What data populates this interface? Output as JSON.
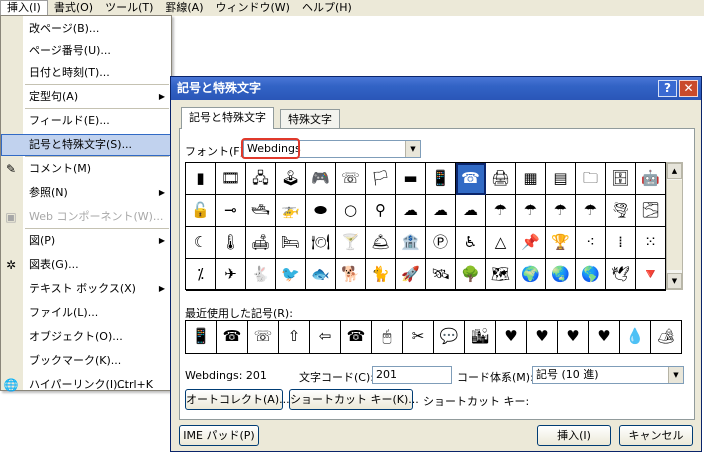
{
  "menubar": {
    "items": [
      "挿入(I)",
      "書式(O)",
      "ツール(T)",
      "罫線(A)",
      "ウィンドウ(W)",
      "ヘルプ(H)"
    ]
  },
  "menu": {
    "items": [
      {
        "label": "改ページ(B)...",
        "arrow": "",
        "shortcut": "",
        "icon": "",
        "state": "normal"
      },
      {
        "label": "ページ番号(U)...",
        "arrow": "",
        "shortcut": "",
        "icon": "",
        "state": "normal"
      },
      {
        "label": "日付と時刻(T)...",
        "arrow": "",
        "shortcut": "",
        "icon": "",
        "state": "normal"
      },
      {
        "label": "定型句(A)",
        "arrow": "▶",
        "shortcut": "",
        "icon": "",
        "state": "normal"
      },
      {
        "label": "フィールド(E)...",
        "arrow": "",
        "shortcut": "",
        "icon": "",
        "state": "normal"
      },
      {
        "label": "記号と特殊文字(S)...",
        "arrow": "",
        "shortcut": "",
        "icon": "",
        "state": "highlight"
      },
      {
        "label": "コメント(M)",
        "arrow": "",
        "shortcut": "",
        "icon": "✎",
        "state": "normal"
      },
      {
        "label": "参照(N)",
        "arrow": "▶",
        "shortcut": "",
        "icon": "",
        "state": "normal"
      },
      {
        "label": "Web コンポーネント(W)...",
        "arrow": "",
        "shortcut": "",
        "icon": "▣",
        "state": "disabled"
      },
      {
        "label": "図(P)",
        "arrow": "▶",
        "shortcut": "",
        "icon": "",
        "state": "normal"
      },
      {
        "label": "図表(G)...",
        "arrow": "",
        "shortcut": "",
        "icon": "✲",
        "state": "normal"
      },
      {
        "label": "テキスト ボックス(X)",
        "arrow": "▶",
        "shortcut": "",
        "icon": "",
        "state": "normal"
      },
      {
        "label": "ファイル(L)...",
        "arrow": "",
        "shortcut": "",
        "icon": "",
        "state": "normal"
      },
      {
        "label": "オブジェクト(O)...",
        "arrow": "",
        "shortcut": "",
        "icon": "",
        "state": "normal"
      },
      {
        "label": "ブックマーク(K)...",
        "arrow": "",
        "shortcut": "",
        "icon": "",
        "state": "normal"
      },
      {
        "label": "ハイパーリンク(I)...",
        "arrow": "",
        "shortcut": "Ctrl+K",
        "icon": "🌐",
        "state": "normal"
      }
    ]
  },
  "dialog": {
    "title": "記号と特殊文字",
    "help_btn": "?",
    "close_btn": "✕",
    "tabs": [
      "記号と特殊文字",
      "特殊文字"
    ],
    "font_label": "フォント(F):",
    "font_value": "Webdings",
    "grid_rows": [
      [
        "▮",
        "🎞",
        "🖧",
        "🕹",
        "🎮",
        "☏",
        "🏳",
        "▬",
        "📱",
        "☎",
        "🖨",
        "▦",
        "▤",
        "🗀",
        "🗄",
        "🤖",
        "🔒",
        "▲"
      ],
      [
        "🔓",
        "⊸",
        "🛥",
        "🚁",
        "⬬",
        "○",
        "⚲",
        "☁",
        "☁",
        "☁",
        "☂",
        "☂",
        "☂",
        "☂",
        "🌪",
        "🌫",
        "⁓",
        "🠟"
      ],
      [
        "☾",
        "🌡",
        "🛋",
        "🛏",
        "🍽",
        "🍸",
        "🛎",
        "🏦",
        "Ⓟ",
        "♿",
        "△",
        "📌",
        "🏆",
        "⁖",
        "⁞",
        "⁙",
        "⠶",
        "▼"
      ],
      [
        "⁒",
        "✈",
        "🐇",
        "🐦",
        "🐟",
        "🐕",
        "🐈",
        "🚀",
        "🛰",
        "🌳",
        "🗺",
        "🌍",
        "🌏",
        "🌎",
        "🕊",
        "🔻",
        "",
        ""
      ]
    ],
    "recent_label": "最近使用した記号(R):",
    "recent_symbols": [
      "📱",
      "☎",
      "☏",
      "⇧",
      "⇦",
      "☎",
      "🖱",
      "✂",
      "💬",
      "🏙",
      "♥",
      "♥",
      "♥",
      "♥",
      "💧",
      "🏕"
    ],
    "char_name": "Webdings: 201",
    "char_code_label": "文字コード(C):",
    "char_code_value": "201",
    "code_system_label": "コード体系(M):",
    "code_system_value": "記号 (10 進)",
    "autocorrect_btn": "オートコレクト(A)...",
    "shortcut_btn": "ショートカット キー(K)...",
    "shortcut_key_label": "ショートカット キー:",
    "ime_pad_btn": "IME パッド(P)",
    "insert_btn": "挿入(I)",
    "cancel_btn": "キャンセル"
  }
}
